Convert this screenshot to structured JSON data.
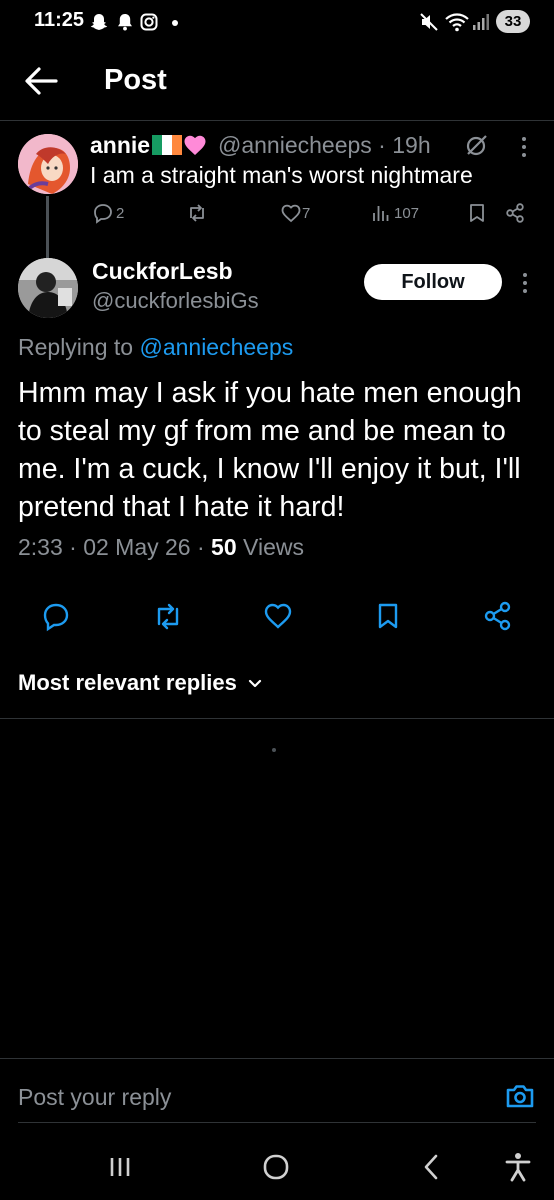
{
  "status_bar": {
    "time": "11:25",
    "battery": "33",
    "left_icons": [
      "snapchat-icon",
      "notification-bell-icon",
      "instagram-icon",
      "dot-icon"
    ],
    "right_icons": [
      "muted-icon",
      "wifi-icon",
      "signal-icon"
    ]
  },
  "header": {
    "title": "Post"
  },
  "parent_post": {
    "display_name": "annie",
    "name_emojis": [
      "ireland-flag-icon",
      "pink-heart-icon"
    ],
    "handle_time": "@anniecheeps · 19h",
    "text": "I am a straight man's worst nightmare",
    "replies": "2",
    "retweets": "",
    "likes": "7",
    "views": "107"
  },
  "reply_post": {
    "display_name": "CuckforLesb",
    "handle": "@cuckforlesbiGs",
    "follow_label": "Follow",
    "replying_prefix": "Replying to ",
    "replying_mention": "@anniecheeps",
    "body": "Hmm may I ask if you hate men enough to steal my gf from me and be mean to me. I'm a cuck, I know I'll enjoy it but, I'll pretend that I hate it hard!",
    "timestamp": "2:33 · 02 May 26 · ",
    "views_count": "50",
    "views_label": " Views"
  },
  "replies_section": {
    "sort_label": "Most relevant replies"
  },
  "composer": {
    "placeholder": "Post your reply"
  },
  "colors": {
    "background": "#000000",
    "accent": "#1d9bf0",
    "secondary_text": "#8b9096",
    "divider": "#2f3336"
  }
}
